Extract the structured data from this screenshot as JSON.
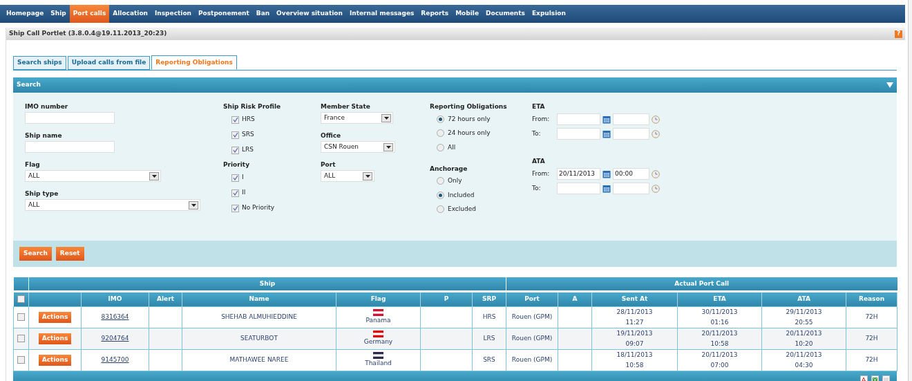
{
  "nav": [
    {
      "label": "Homepage",
      "selected": false
    },
    {
      "label": "Ship",
      "selected": false
    },
    {
      "label": "Port calls",
      "selected": true
    },
    {
      "label": "Allocation",
      "selected": false
    },
    {
      "label": "Inspection",
      "selected": false
    },
    {
      "label": "Postponement",
      "selected": false
    },
    {
      "label": "Ban",
      "selected": false
    },
    {
      "label": "Overview situation",
      "selected": false
    },
    {
      "label": "Internal messages",
      "selected": false
    },
    {
      "label": "Reports",
      "selected": false
    },
    {
      "label": "Mobile",
      "selected": false
    },
    {
      "label": "Documents",
      "selected": false
    },
    {
      "label": "Expulsion",
      "selected": false
    }
  ],
  "portlet": {
    "title": "Ship Call Portlet (3.8.0.4@19.11.2013_20:23)",
    "help": "?"
  },
  "tabs": [
    {
      "label": "Search ships",
      "selected": false
    },
    {
      "label": "Upload calls from file",
      "selected": false
    },
    {
      "label": "Reporting Obligations",
      "selected": true
    }
  ],
  "search": {
    "title": "Search",
    "column_1": [
      {
        "label": "IMO number",
        "kind": "text"
      },
      {
        "label": "Ship name",
        "kind": "text"
      },
      {
        "label": "Flag",
        "kind": "select",
        "value": "ALL"
      },
      {
        "label": "Ship type",
        "kind": "select",
        "value": "ALL"
      }
    ],
    "ship_risk_profile": {
      "label": "Ship Risk Profile",
      "options": [
        {
          "label": "HRS",
          "checked": true
        },
        {
          "label": "SRS",
          "checked": true
        },
        {
          "label": "LRS",
          "checked": true
        }
      ]
    },
    "priority": {
      "label": "Priority",
      "options": [
        {
          "label": "I",
          "checked": true
        },
        {
          "label": "II",
          "checked": true
        },
        {
          "label": "No Priority",
          "checked": true
        }
      ]
    },
    "column_3": [
      {
        "label": "Member State",
        "value": "France"
      },
      {
        "label": "Office",
        "value": "CSN Rouen"
      },
      {
        "label": "Port",
        "value": "ALL"
      }
    ],
    "reporting_obligations": {
      "label": "Reporting Obligations",
      "options": [
        {
          "label": "72 hours only",
          "selected": true
        },
        {
          "label": "24 hours only",
          "selected": false
        },
        {
          "label": "All",
          "selected": false
        }
      ]
    },
    "anchorage": {
      "label": "Anchorage",
      "options": [
        {
          "label": "Only",
          "selected": false
        },
        {
          "label": "Included",
          "selected": true
        },
        {
          "label": "Excluded",
          "selected": false
        }
      ]
    },
    "date_ranges": [
      {
        "label": "ETA",
        "rows": [
          {
            "label": "From:"
          },
          {
            "label": "To:"
          }
        ]
      },
      {
        "label": "ATA",
        "rows": [
          {
            "label": "From:",
            "date": "20/11/2013",
            "time": "00:00"
          },
          {
            "label": "To:"
          }
        ]
      }
    ],
    "buttons": [
      "Search",
      "Reset"
    ]
  },
  "table": {
    "groups": [
      "Ship",
      "Actual Port Call"
    ],
    "columns": [
      "IMO",
      "Alert",
      "Name",
      "Flag",
      "P",
      "SRP",
      "Port",
      "A",
      "Sent At",
      "ETA",
      "ATA",
      "Reason"
    ],
    "select_all_checked": false,
    "rows": [
      {
        "checked": false,
        "action": "Actions",
        "imo": "8316364",
        "name": "SHEHAB ALMUHIEDDINE",
        "flag": "Panama",
        "color": "#d21034",
        "srp": "HRS",
        "port": "Rouen (GPM)",
        "sent_at": [
          "28/11/2013",
          "11:27"
        ],
        "eta": [
          "30/11/2013",
          "01:16"
        ],
        "ata": [
          "29/11/2013",
          "20:55"
        ],
        "reason": "72H"
      },
      {
        "checked": false,
        "action": "Actions",
        "imo": "9204764",
        "name": "SEATURBOT",
        "flag": "Germany",
        "color": "#dd0000",
        "srp": "LRS",
        "port": "Rouen (GPM)",
        "sent_at": [
          "19/11/2013",
          "09:07"
        ],
        "eta": [
          "20/11/2013",
          "10:58"
        ],
        "ata": [
          "20/11/2013",
          "10:20"
        ],
        "reason": "72H"
      },
      {
        "checked": false,
        "action": "Actions",
        "imo": "9145700",
        "name": "MATHAWEE NAREE",
        "flag": "Thailand",
        "color": "#2d2a4a",
        "srp": "SRS",
        "port": "Rouen (GPM)",
        "sent_at": [
          "18/11/2013",
          "10:58"
        ],
        "eta": [
          "20/11/2013",
          "07:00"
        ],
        "ata": [
          "20/11/2013",
          "04:30"
        ],
        "reason": "72H"
      }
    ]
  }
}
